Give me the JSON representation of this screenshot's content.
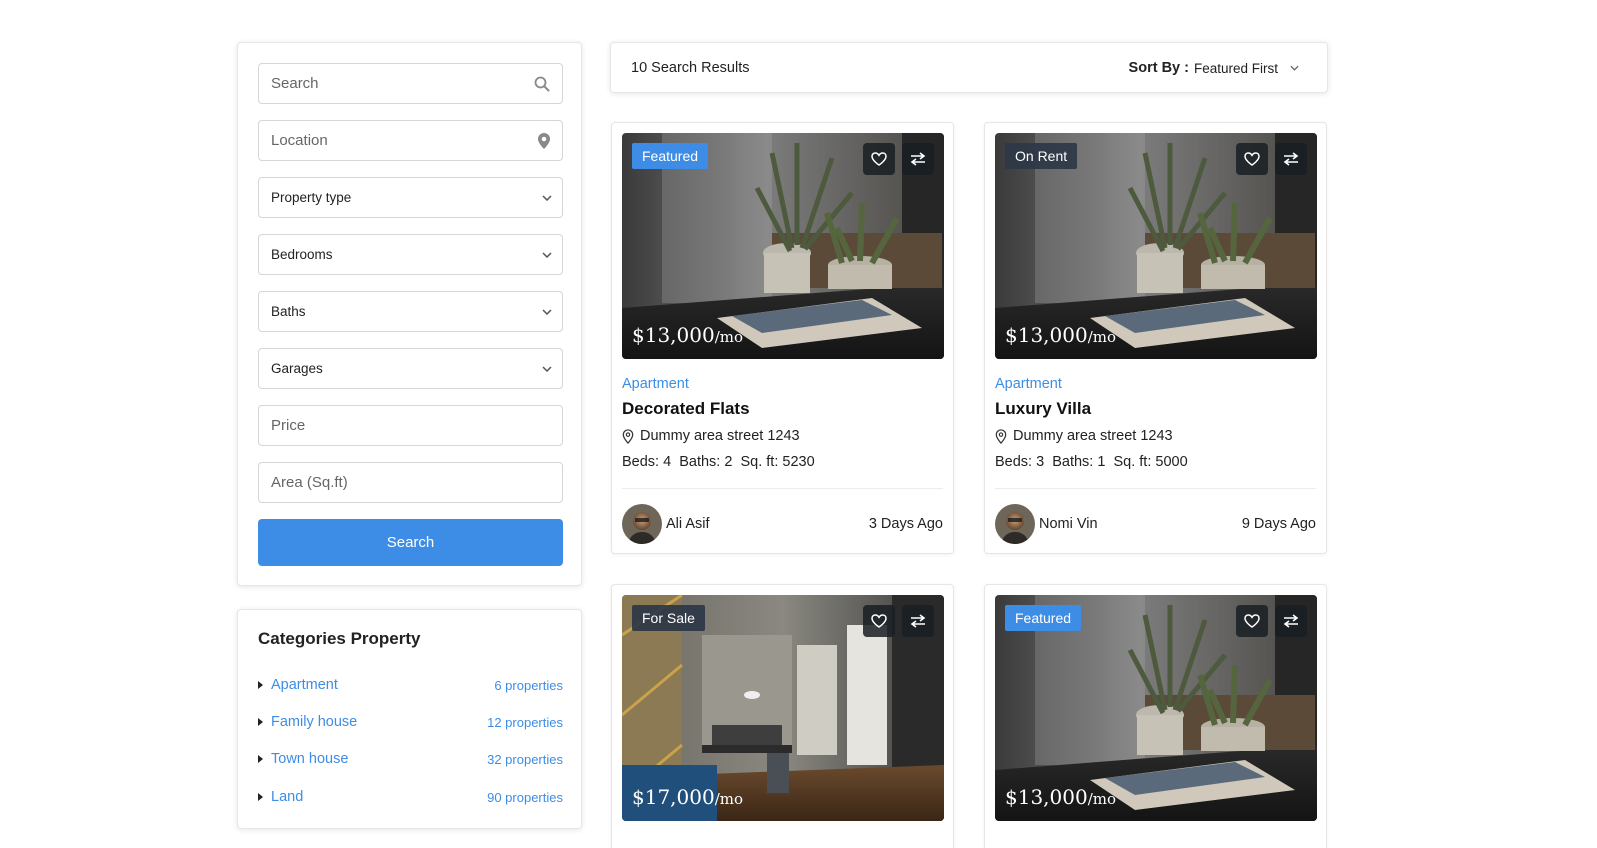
{
  "filters": {
    "search_placeholder": "Search",
    "location_placeholder": "Location",
    "property_type": "Property type",
    "bedrooms": "Bedrooms",
    "baths": "Baths",
    "garages": "Garages",
    "price_placeholder": "Price",
    "area_placeholder": "Area (Sq.ft)",
    "search_button": "Search"
  },
  "categories": {
    "title": "Categories Property",
    "items": [
      {
        "name": "Apartment",
        "count": "6 properties"
      },
      {
        "name": "Family house",
        "count": "12 properties"
      },
      {
        "name": "Town house",
        "count": "32 properties"
      },
      {
        "name": "Land",
        "count": "90 properties"
      }
    ]
  },
  "results": {
    "count_text": "10 Search Results",
    "sort_label": "Sort By :",
    "sort_value": "Featured First"
  },
  "colors": {
    "accent": "#3d8de6",
    "badge_dark": "#2d3746"
  },
  "cards": [
    {
      "badge": "Featured",
      "price": "$13,000",
      "per": "/mo",
      "type": "Apartment",
      "title": "Decorated Flats",
      "address": "Dummy area street 1243",
      "specs": "Beds: 4  Baths: 2  Sq. ft: 5230",
      "agent": "Ali Asif",
      "date": "3 Days Ago"
    },
    {
      "badge": "On Rent",
      "price": "$13,000",
      "per": "/mo",
      "type": "Apartment",
      "title": "Luxury Villa",
      "address": "Dummy area street 1243",
      "specs": "Beds: 3  Baths: 1  Sq. ft: 5000",
      "agent": "Nomi Vin",
      "date": "9 Days Ago"
    },
    {
      "badge": "For Sale",
      "price": "$17,000",
      "per": "/mo"
    },
    {
      "badge": "Featured",
      "price": "$13,000",
      "per": "/mo"
    }
  ]
}
